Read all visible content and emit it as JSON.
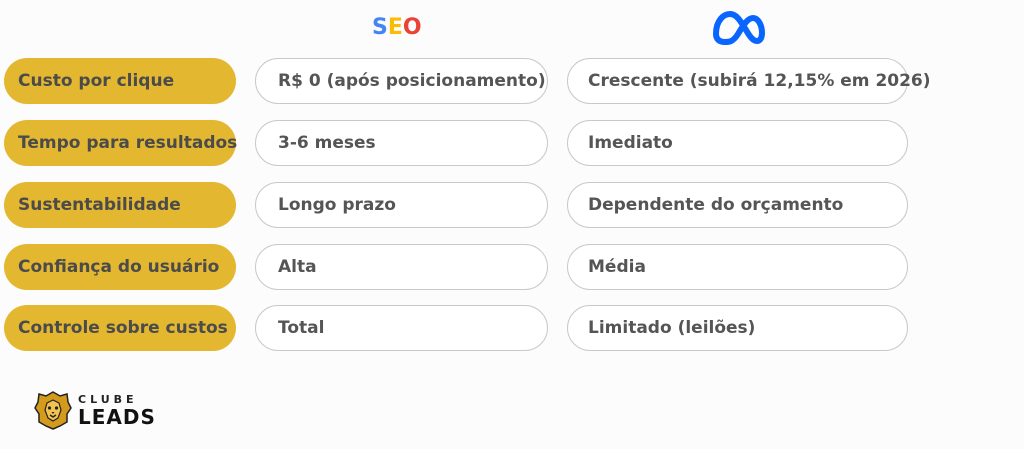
{
  "header": {
    "col1_logo": {
      "text": [
        "S",
        "E",
        "O"
      ],
      "colors": [
        "#4285F4",
        "#FBBC05",
        "#EA4335"
      ]
    },
    "col2_logo": {
      "icon": "meta-infinity-icon",
      "color": "#0866FF"
    }
  },
  "rows": [
    {
      "label": "Custo por clique",
      "seo": "R$ 0 (após posicionamento)",
      "meta": "Crescente (subirá 12,15% em 2026)"
    },
    {
      "label": "Tempo para resultados",
      "seo": "3-6 meses",
      "meta": "Imediato"
    },
    {
      "label": "Sustentabilidade",
      "seo": "Longo prazo",
      "meta": "Dependente do orçamento"
    },
    {
      "label": "Confiança do usuário",
      "seo": "Alta",
      "meta": "Média"
    },
    {
      "label": "Controle sobre custos",
      "seo": "Total",
      "meta": "Limitado (leilões)"
    }
  ],
  "brand": {
    "top": "CLUBE",
    "bottom": "LEADS",
    "icon": "lion-icon"
  },
  "colors": {
    "label_bg": "#e3b72f",
    "cell_border": "#c9c9c9"
  }
}
